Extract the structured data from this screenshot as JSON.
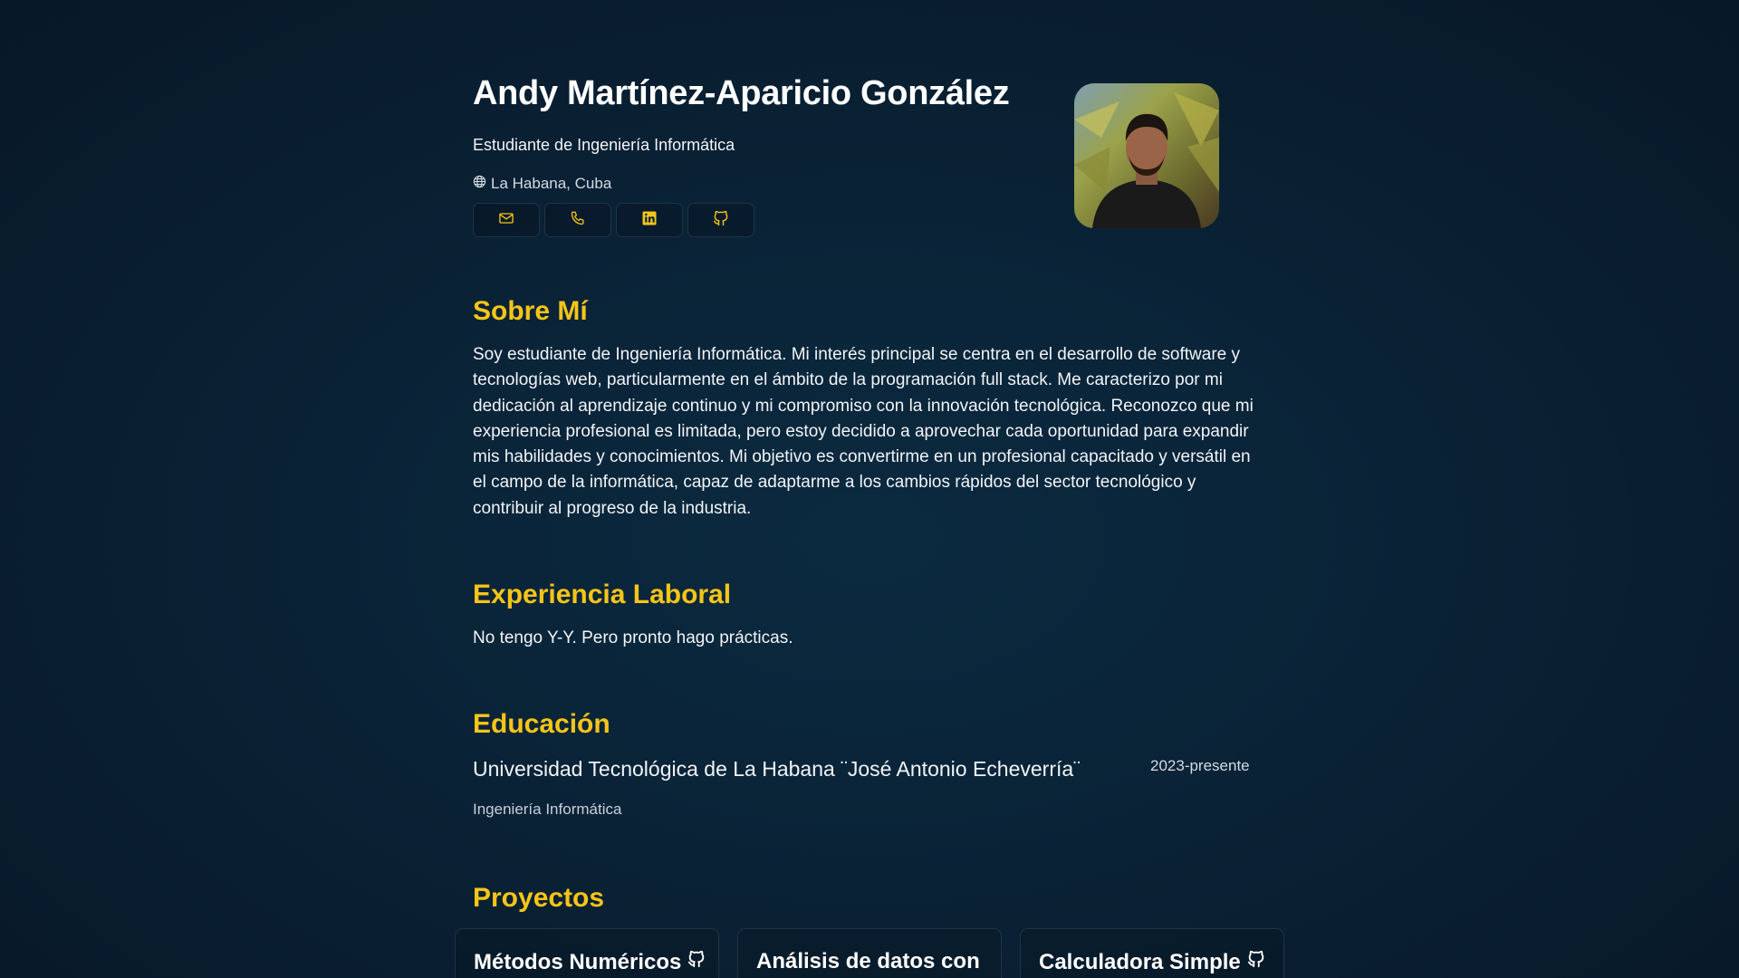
{
  "header": {
    "name": "Andy Martínez-Aparicio González",
    "subtitle": "Estudiante de Ingeniería Informática",
    "location": "La Habana, Cuba",
    "contacts": [
      {
        "icon": "mail-icon"
      },
      {
        "icon": "phone-icon"
      },
      {
        "icon": "linkedin-icon"
      },
      {
        "icon": "github-icon"
      }
    ],
    "accent_color": "#f5c518"
  },
  "about": {
    "title": "Sobre Mí",
    "text": "Soy estudiante de Ingeniería Informática. Mi interés principal se centra en el desarrollo de software y tecnologías web, particularmente en el ámbito de la programación full stack. Me caracterizo por mi dedicación al aprendizaje continuo y mi compromiso con la innovación tecnológica. Reconozco que mi experiencia profesional es limitada, pero estoy decidido a aprovechar cada oportunidad para expandir mis habilidades y conocimientos. Mi objetivo es convertirme en un profesional capacitado y versátil en el campo de la informática, capaz de adaptarme a los cambios rápidos del sector tecnológico y contribuir al progreso de la industria."
  },
  "experience": {
    "title": "Experiencia Laboral",
    "text": "No tengo Y-Y. Pero pronto hago prácticas."
  },
  "education": {
    "title": "Educación",
    "school": "Universidad Tecnológica de La Habana ¨José Antonio Echeverría¨",
    "date": "2023-presente",
    "degree": "Ingeniería Informática"
  },
  "projects": {
    "title": "Proyectos",
    "items": [
      {
        "name": "Métodos Numéricos",
        "icon": "github-icon"
      },
      {
        "name": "Análisis de datos con",
        "icon": ""
      },
      {
        "name": "Calculadora Simple",
        "icon": "github-icon"
      }
    ]
  }
}
